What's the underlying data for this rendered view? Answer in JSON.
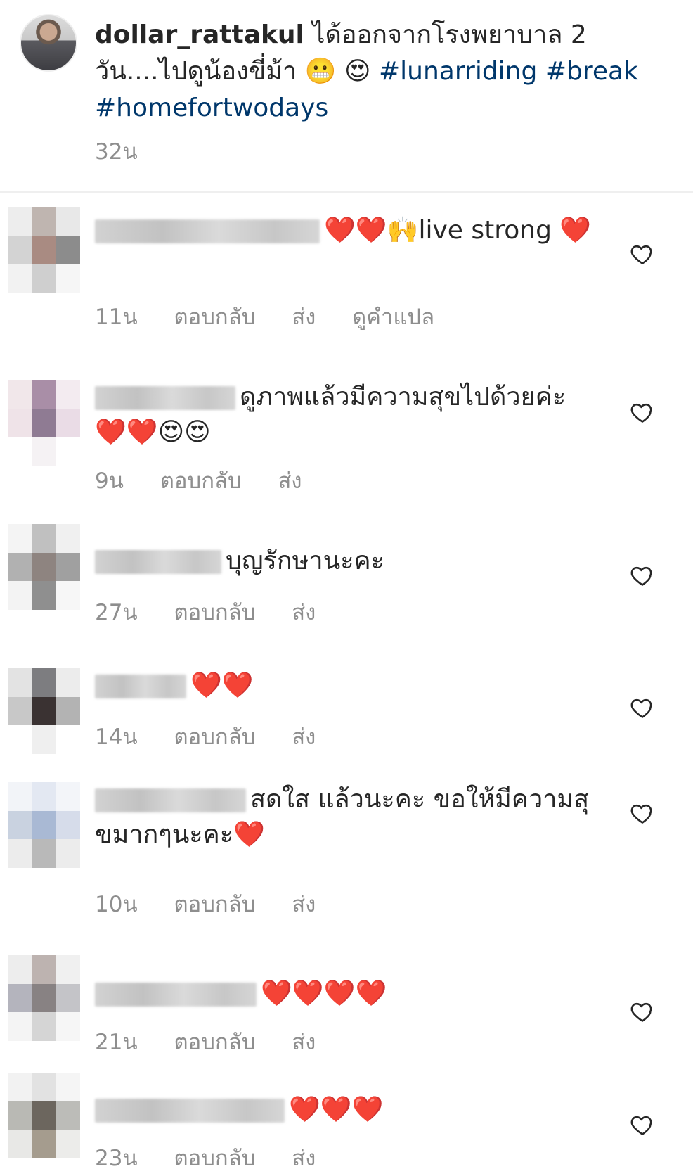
{
  "post": {
    "username": "dollar_rattakul",
    "caption_text": "ได้ออกจากโรงพยาบาล 2 วัน....ไปดูน้องขี่ม้า",
    "caption_emojis": "😬 😍",
    "hashtags": [
      "#lunarriding",
      "#break",
      "#homefortwodays"
    ],
    "time": "32น"
  },
  "labels": {
    "reply": "ตอบกลับ",
    "send": "ส่ง",
    "translate": "ดูคำแปล"
  },
  "comments": [
    {
      "text": "❤️❤️🙌live strong ❤️",
      "time": "11น",
      "show_translate": true
    },
    {
      "text": "ดูภาพแล้วมีความสุขไปด้วยค่ะ ❤️❤️😍😍",
      "time": "9น"
    },
    {
      "text": "บุญรักษานะคะ",
      "time": "27น"
    },
    {
      "text": "❤️❤️",
      "time": "14น"
    },
    {
      "text": "สดใส แล้วนะคะ ขอให้มีความสุขมากๆนะคะ❤️",
      "time": "10น"
    },
    {
      "text": "❤️❤️❤️❤️",
      "time": "21น"
    },
    {
      "text": "❤️❤️❤️",
      "time": "23น"
    }
  ],
  "colors": {
    "hashtag": "#00376b",
    "secondary_text": "#8e8e8e",
    "heart": "#e0242c"
  },
  "icons": {
    "like": "heart-outline-icon"
  }
}
